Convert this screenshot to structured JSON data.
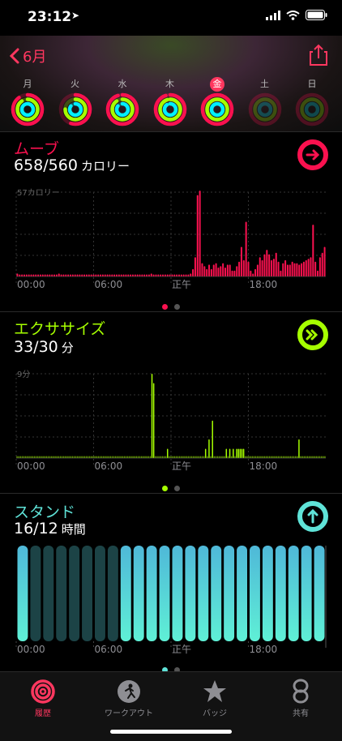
{
  "status": {
    "time": "23:12",
    "location_icon": "location-arrow-icon"
  },
  "header": {
    "back_label": "6月",
    "share_icon": "share-icon"
  },
  "days": [
    {
      "label": "月",
      "move": 0.9,
      "exercise": 0.9,
      "stand": 0.95,
      "today": false
    },
    {
      "label": "火",
      "move": 0.55,
      "exercise": 0.75,
      "stand": 0.85,
      "today": false
    },
    {
      "label": "水",
      "move": 0.95,
      "exercise": 0.9,
      "stand": 0.85,
      "today": false
    },
    {
      "label": "木",
      "move": 0.95,
      "exercise": 0.95,
      "stand": 0.9,
      "today": false
    },
    {
      "label": "金",
      "move": 1,
      "exercise": 1,
      "stand": 1,
      "today": true
    },
    {
      "label": "土",
      "move": 0,
      "exercise": 0,
      "stand": 0,
      "today": false
    },
    {
      "label": "日",
      "move": 0,
      "exercise": 0,
      "stand": 0,
      "today": false
    }
  ],
  "colors": {
    "move": "#fa114f",
    "exercise": "#a6ff00",
    "stand": "#00f0ff",
    "stand_bar_active": "#5fe3d8"
  },
  "move": {
    "title": "ムーブ",
    "value": "658/560",
    "unit": "カロリー",
    "ymax_label": "57カロリー",
    "x_labels": [
      "00:00",
      "06:00",
      "正午",
      "18:00"
    ]
  },
  "exercise": {
    "title": "エクササイズ",
    "value": "33/30",
    "unit": "分",
    "ymax_label": "9分",
    "x_labels": [
      "00:00",
      "06:00",
      "正午",
      "18:00"
    ]
  },
  "stand": {
    "title": "スタンド",
    "value": "16/12",
    "unit": "時間",
    "x_labels": [
      "00:00",
      "06:00",
      "正午",
      "18:00"
    ]
  },
  "chart_data": [
    {
      "type": "bar",
      "title": "ムーブ",
      "ylabel": "57カロリー",
      "ylim": [
        0,
        57
      ],
      "x_labels": [
        "00:00",
        "06:00",
        "正午",
        "18:00"
      ],
      "values": [
        2,
        1,
        1,
        1,
        1,
        1,
        1,
        1,
        1,
        1,
        1,
        1,
        1,
        1,
        1,
        1,
        1,
        1,
        2,
        1,
        1,
        1,
        1,
        1,
        1,
        1,
        1,
        1,
        1,
        1,
        1,
        1,
        1,
        1,
        1,
        1,
        1,
        1,
        1,
        1,
        1,
        1,
        1,
        1,
        1,
        1,
        1,
        1,
        1,
        1,
        1,
        1,
        1,
        1,
        1,
        1,
        1,
        1,
        2,
        1,
        1,
        1,
        1,
        1,
        1,
        1,
        1,
        1,
        1,
        1,
        1,
        1,
        1,
        1,
        1,
        2,
        5,
        13,
        55,
        58,
        9,
        7,
        5,
        8,
        5,
        8,
        9,
        6,
        7,
        9,
        6,
        8,
        8,
        4,
        4,
        7,
        10,
        20,
        11,
        37,
        10,
        4,
        2,
        5,
        8,
        13,
        11,
        15,
        18,
        15,
        11,
        12,
        16,
        10,
        4,
        9,
        11,
        8,
        8,
        10,
        9,
        9,
        8,
        9,
        10,
        11,
        12,
        13,
        35,
        10,
        4,
        13,
        16,
        20
      ]
    },
    {
      "type": "bar",
      "title": "エクササイズ",
      "ylabel": "9分",
      "ylim": [
        0,
        9
      ],
      "x_labels": [
        "00:00",
        "06:00",
        "正午",
        "18:00"
      ],
      "values": [
        0,
        0,
        0,
        0,
        0,
        0,
        0,
        0,
        0,
        0,
        0,
        0,
        0,
        0,
        0,
        0,
        0,
        0,
        0,
        0,
        0,
        0,
        0,
        0,
        0,
        0,
        0,
        0,
        0,
        0,
        0,
        0,
        0,
        0,
        0,
        0,
        0,
        0,
        0,
        0,
        0,
        0,
        0,
        0,
        0,
        0,
        0,
        0,
        0,
        0,
        0,
        0,
        0,
        0,
        0,
        0,
        0,
        0,
        0,
        0,
        0,
        0,
        0,
        0,
        0,
        0,
        0,
        0,
        0,
        0,
        0,
        0,
        0,
        0,
        0,
        0,
        0,
        0,
        9,
        8,
        0,
        0,
        0,
        0,
        0,
        0,
        0,
        1,
        0,
        0,
        0,
        0,
        0,
        0,
        0,
        0,
        0,
        0,
        0,
        0,
        0,
        0,
        0,
        0,
        0,
        0,
        0,
        0,
        0,
        1,
        0,
        2,
        0,
        4,
        0,
        0,
        0,
        0,
        0,
        0,
        0,
        1,
        0,
        1,
        0,
        1,
        0,
        1,
        1,
        1,
        1,
        1,
        0,
        0,
        0,
        0,
        0,
        0,
        0,
        0,
        0,
        0,
        0,
        0,
        0,
        0,
        0,
        0,
        0,
        0,
        0,
        0,
        0,
        0,
        0,
        0,
        0,
        0,
        0,
        0,
        0,
        0,
        0,
        2,
        0,
        0,
        0,
        0,
        0,
        0,
        0,
        0,
        0,
        0,
        0,
        0,
        0,
        0,
        0
      ]
    },
    {
      "type": "bar",
      "title": "スタンド",
      "ylim": [
        0,
        1
      ],
      "x_labels": [
        "00:00",
        "06:00",
        "正午",
        "18:00"
      ],
      "values": [
        1,
        0,
        0,
        0,
        0,
        0,
        0,
        0,
        1,
        1,
        1,
        1,
        1,
        1,
        1,
        1,
        1,
        1,
        1,
        1,
        1,
        1,
        1,
        1
      ]
    }
  ],
  "tabs": [
    {
      "label": "履歴",
      "icon": "activity-rings-icon",
      "active": true
    },
    {
      "label": "ワークアウト",
      "icon": "runner-icon",
      "active": false
    },
    {
      "label": "バッジ",
      "icon": "star-badge-icon",
      "active": false
    },
    {
      "label": "共有",
      "icon": "sharing-icon",
      "active": false
    }
  ]
}
